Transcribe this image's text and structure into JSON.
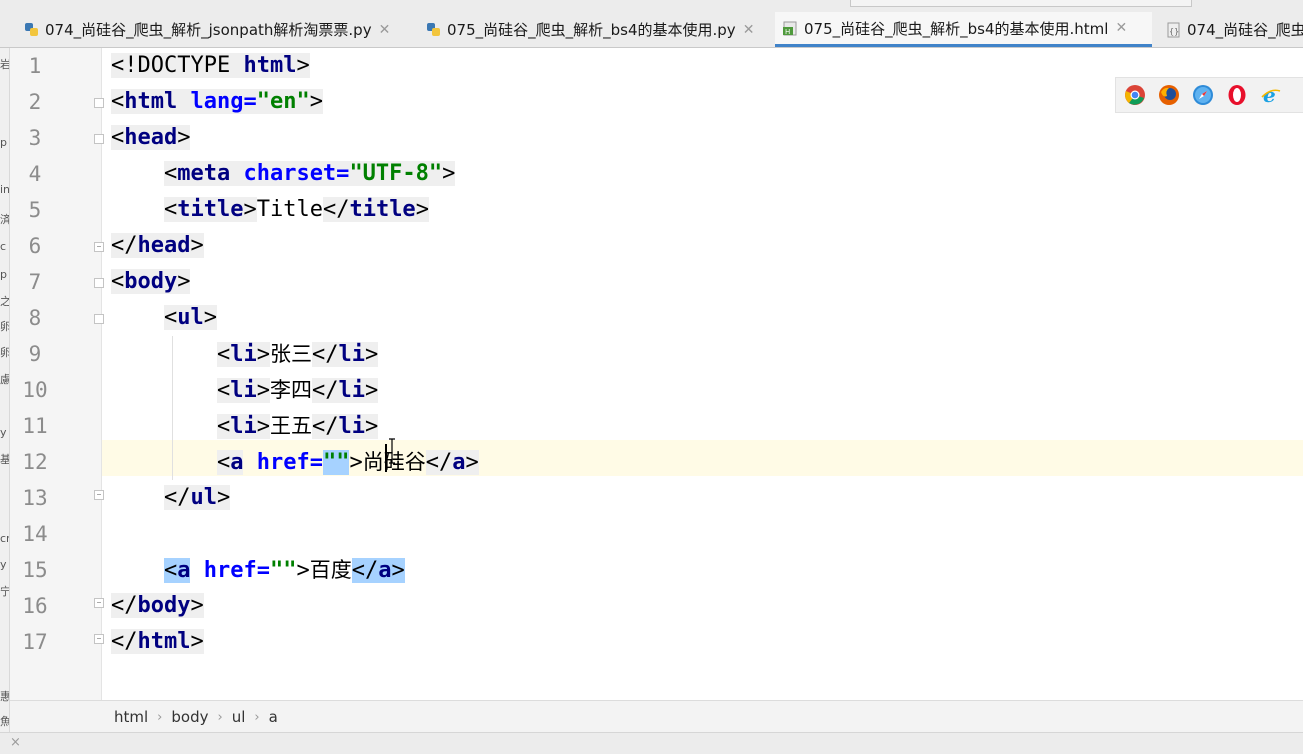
{
  "tabs": [
    {
      "label": "074_尚硅谷_爬虫_解析_jsonpath解析淘票票.py",
      "type": "py",
      "active": false
    },
    {
      "label": "075_尚硅谷_爬虫_解析_bs4的基本使用.py",
      "type": "py",
      "active": false
    },
    {
      "label": "075_尚硅谷_爬虫_解析_bs4的基本使用.html",
      "type": "html",
      "active": true
    },
    {
      "label": "074_尚硅谷_爬虫",
      "type": "json",
      "active": false
    }
  ],
  "editor": {
    "line_numbers": [
      "1",
      "2",
      "3",
      "4",
      "5",
      "6",
      "7",
      "8",
      "9",
      "10",
      "11",
      "12",
      "13",
      "14",
      "15",
      "16",
      "17"
    ],
    "current_line": "12",
    "code": {
      "l1": {
        "open": "<!DOCTYPE ",
        "kw": "html",
        "close": ">"
      },
      "l2": {
        "lt": "<",
        "tag": "html",
        "attr": " lang=",
        "val": "\"en\"",
        "gt": ">"
      },
      "l3": {
        "lt": "<",
        "tag": "head",
        "gt": ">"
      },
      "l4": {
        "lt": "<",
        "tag": "meta",
        "attr": " charset=",
        "val": "\"UTF-8\"",
        "gt": ">"
      },
      "l5": {
        "lt": "<",
        "tag": "title",
        "gt": ">",
        "text": "Title",
        "lt2": "</",
        "tag2": "title",
        "gt2": ">"
      },
      "l6": {
        "lt": "</",
        "tag": "head",
        "gt": ">"
      },
      "l7": {
        "lt": "<",
        "tag": "body",
        "gt": ">"
      },
      "l8": {
        "lt": "<",
        "tag": "ul",
        "gt": ">"
      },
      "l9": {
        "lt": "<",
        "tag": "li",
        "gt": ">",
        "text": "张三",
        "lt2": "</",
        "tag2": "li",
        "gt2": ">"
      },
      "l10": {
        "lt": "<",
        "tag": "li",
        "gt": ">",
        "text": "李四",
        "lt2": "</",
        "tag2": "li",
        "gt2": ">"
      },
      "l11": {
        "lt": "<",
        "tag": "li",
        "gt": ">",
        "text": "王五",
        "lt2": "</",
        "tag2": "li",
        "gt2": ">"
      },
      "l12": {
        "lt": "<",
        "tag": "a",
        "attr": " href=",
        "val": "\"\"",
        "gt": ">",
        "text": "尚硅谷",
        "lt2": "</",
        "tag2": "a",
        "gt2": ">"
      },
      "l13": {
        "lt": "</",
        "tag": "ul",
        "gt": ">"
      },
      "l15": {
        "lt": "<",
        "tag": "a",
        "attr": " href=",
        "val": "\"\"",
        "gt": ">",
        "text": "百度",
        "lt2": "</",
        "tag2": "a",
        "gt2": ">"
      },
      "l16": {
        "lt": "</",
        "tag": "body",
        "gt": ">"
      },
      "l17": {
        "lt": "</",
        "tag": "html",
        "gt": ">"
      }
    }
  },
  "browser_icons": [
    "chrome-icon",
    "firefox-icon",
    "safari-icon",
    "opera-icon",
    "ie-icon"
  ],
  "breadcrumb": [
    "html",
    "body",
    "ul",
    "a"
  ],
  "left_strip_chars": [
    "岩",
    "p",
    "in",
    "済",
    "c",
    "p",
    "之",
    "卵",
    "卵",
    "慮",
    "y",
    "基",
    "cr",
    "y",
    "宁",
    "惠",
    "魚"
  ],
  "bottom_close": "×"
}
